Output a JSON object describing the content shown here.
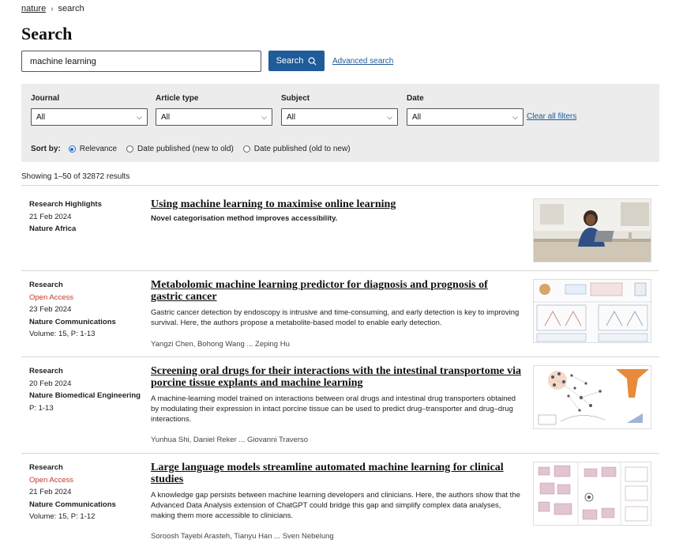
{
  "breadcrumb": {
    "home": "nature",
    "current": "search"
  },
  "page_title": "Search",
  "search": {
    "value": "machine learning",
    "button_label": "Search",
    "advanced_label": "Advanced search"
  },
  "filters": {
    "journal": {
      "label": "Journal",
      "value": "All"
    },
    "article_type": {
      "label": "Article type",
      "value": "All"
    },
    "subject": {
      "label": "Subject",
      "value": "All"
    },
    "date": {
      "label": "Date",
      "value": "All"
    },
    "clear_label": "Clear all filters"
  },
  "sort": {
    "label": "Sort by:",
    "options": [
      "Relevance",
      "Date published (new to old)",
      "Date published (old to new)"
    ],
    "selected": "Relevance"
  },
  "results_count": "Showing 1–50 of 32872 results",
  "colors": {
    "accent": "#1f5c99",
    "open_access": "#c0392b"
  },
  "results": [
    {
      "type": "Research Highlights",
      "open_access": "",
      "date": "21 Feb 2024",
      "journal": "Nature Africa",
      "volume": "",
      "title": "Using machine learning to maximise online learning",
      "description": "Novel categorisation method improves accessibility.",
      "authors": ""
    },
    {
      "type": "Research",
      "open_access": "Open Access",
      "date": "23 Feb 2024",
      "journal": "Nature Communications",
      "volume": "Volume: 15, P: 1-13",
      "title": "Metabolomic machine learning predictor for diagnosis and prognosis of gastric cancer",
      "description": "Gastric cancer detection by endoscopy is intrusive and time-consuming, and early detection is key to improving survival. Here, the authors propose a metabolite-based model to enable early detection.",
      "authors": "Yangzi Chen, Bohong Wang ... Zeping Hu"
    },
    {
      "type": "Research",
      "open_access": "",
      "date": "20 Feb 2024",
      "journal": "Nature Biomedical Engineering",
      "volume": "P: 1-13",
      "title": "Screening oral drugs for their interactions with the intestinal transportome via porcine tissue explants and machine learning",
      "description": "A machine-learning model trained on interactions between oral drugs and intestinal drug transporters obtained by modulating their expression in intact porcine tissue can be used to predict drug–transporter and drug–drug interactions.",
      "authors": "Yunhua Shi, Daniel Reker ... Giovanni Traverso"
    },
    {
      "type": "Research",
      "open_access": "Open Access",
      "date": "21 Feb 2024",
      "journal": "Nature Communications",
      "volume": "Volume: 15, P: 1-12",
      "title": "Large language models streamline automated machine learning for clinical studies",
      "description": "A knowledge gap persists between machine learning developers and clinicians. Here, the authors show that the Advanced Data Analysis extension of ChatGPT could bridge this gap and simplify complex data analyses, making them more accessible to clinicians.",
      "authors": "Soroosh Tayebi Arasteh, Tianyu Han ... Sven Nebelung"
    }
  ]
}
